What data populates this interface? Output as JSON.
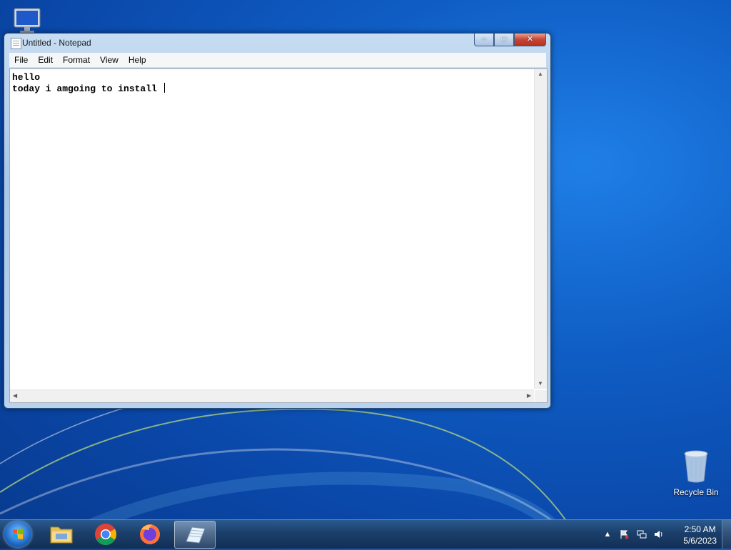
{
  "window": {
    "title": "Untitled - Notepad",
    "buttons": {
      "minimize": "−",
      "maximize": "□",
      "close": "✕"
    }
  },
  "menubar": {
    "items": [
      "File",
      "Edit",
      "Format",
      "View",
      "Help"
    ]
  },
  "editor": {
    "lines": [
      "hello",
      "today i amgoing to install "
    ]
  },
  "desktop": {
    "icons": [
      {
        "label": "Recycle Bin",
        "icon": "recycle-bin-icon"
      },
      {
        "label": "",
        "icon": "computer-icon"
      }
    ]
  },
  "taskbar": {
    "pinned": [
      {
        "name": "windows-explorer",
        "icon": "folder-icon"
      },
      {
        "name": "chrome",
        "icon": "chrome-icon"
      },
      {
        "name": "firefox",
        "icon": "firefox-icon"
      },
      {
        "name": "notepad",
        "icon": "notepad-icon",
        "active": true
      }
    ],
    "tray": {
      "time": "2:50 AM",
      "date": "5/6/2023",
      "icons": [
        "show-hidden-icons-arrow",
        "action-center-flag-icon",
        "network-icon",
        "volume-icon"
      ]
    }
  },
  "colors": {
    "desktop_blue": "#0f5dc4",
    "taskbar": "#1b3f6a",
    "window_frame": "#b9d3ee",
    "close_red": "#c74534"
  }
}
